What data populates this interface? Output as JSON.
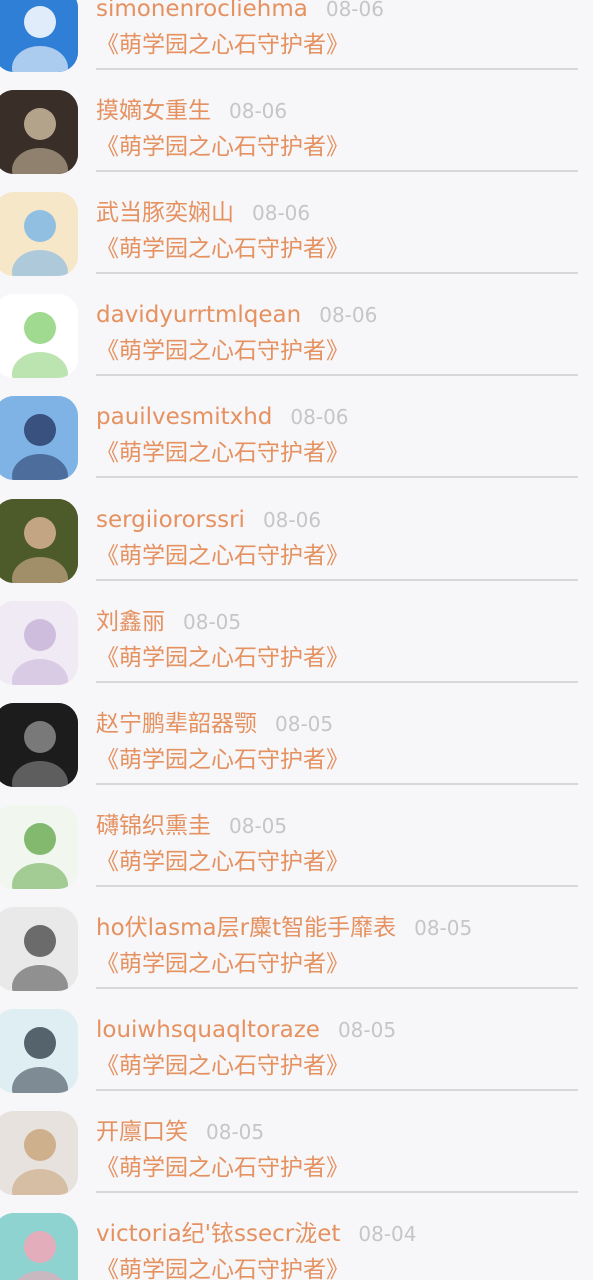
{
  "items": [
    {
      "name": "simonenrocliehma",
      "date": "08-06",
      "title": "《萌学园之心石守护者》",
      "avatar": "robot-avatar",
      "bg": "#2f7fd6",
      "fg": "#ffffff"
    },
    {
      "name": "摸嫡女重生",
      "date": "08-06",
      "title": "《萌学园之心石守护者》",
      "avatar": "skull-poster-avatar",
      "bg": "#3a2e28",
      "fg": "#c9b79c"
    },
    {
      "name": "武当豚奕娴山",
      "date": "08-06",
      "title": "《萌学园之心石守护者》",
      "avatar": "anime-girl-avatar",
      "bg": "#f6e7c9",
      "fg": "#7fb7e6"
    },
    {
      "name": "davidyurrtmlqean",
      "date": "08-06",
      "title": "《萌学园之心石守护者》",
      "avatar": "green-dinosaur-avatar",
      "bg": "#ffffff",
      "fg": "#8fd27c"
    },
    {
      "name": "pauilvesmitxhd",
      "date": "08-06",
      "title": "《萌学园之心石守护者》",
      "avatar": "anime-boy-avatar",
      "bg": "#7fb3e6",
      "fg": "#2b3f6b"
    },
    {
      "name": "sergiiororssri",
      "date": "08-06",
      "title": "《萌学园之心石守护者》",
      "avatar": "woman-portrait-avatar",
      "bg": "#4d5a2a",
      "fg": "#d8b394"
    },
    {
      "name": "刘鑫丽",
      "date": "08-05",
      "title": "《萌学园之心石守护者》",
      "avatar": "pastel-figure-avatar",
      "bg": "#efeaf3",
      "fg": "#c8b5d8"
    },
    {
      "name": "赵宁鹏辈韶器颚",
      "date": "08-05",
      "title": "《萌学园之心石守护者》",
      "avatar": "dark-portrait-avatar",
      "bg": "#1c1c1c",
      "fg": "#8a8a8a"
    },
    {
      "name": "礴锦织熏圭",
      "date": "08-05",
      "title": "《萌学园之心石守护者》",
      "avatar": "flower-avatar",
      "bg": "#f1f7ef",
      "fg": "#6fae57"
    },
    {
      "name": "ho伏lasma层r麋t智能手靡表",
      "date": "08-05",
      "title": "《萌学园之心石守护者》",
      "avatar": "woman-bw-avatar",
      "bg": "#e9e9e9",
      "fg": "#555555"
    },
    {
      "name": "louiwhsquaqltoraze",
      "date": "08-05",
      "title": "《萌学园之心石守护者》",
      "avatar": "dolphin-avatar",
      "bg": "#dfeef3",
      "fg": "#3d4a55"
    },
    {
      "name": "开廪口笑",
      "date": "08-05",
      "title": "《萌学园之心石守护者》",
      "avatar": "blonde-woman-avatar",
      "bg": "#e7e2dd",
      "fg": "#c9a77e"
    },
    {
      "name": "victoria纪'铱ssecr泷et",
      "date": "08-04",
      "title": "《萌学园之心石守护者》",
      "avatar": "cartoon-pig-avatar",
      "bg": "#8fd3d0",
      "fg": "#f2a6b8"
    }
  ]
}
